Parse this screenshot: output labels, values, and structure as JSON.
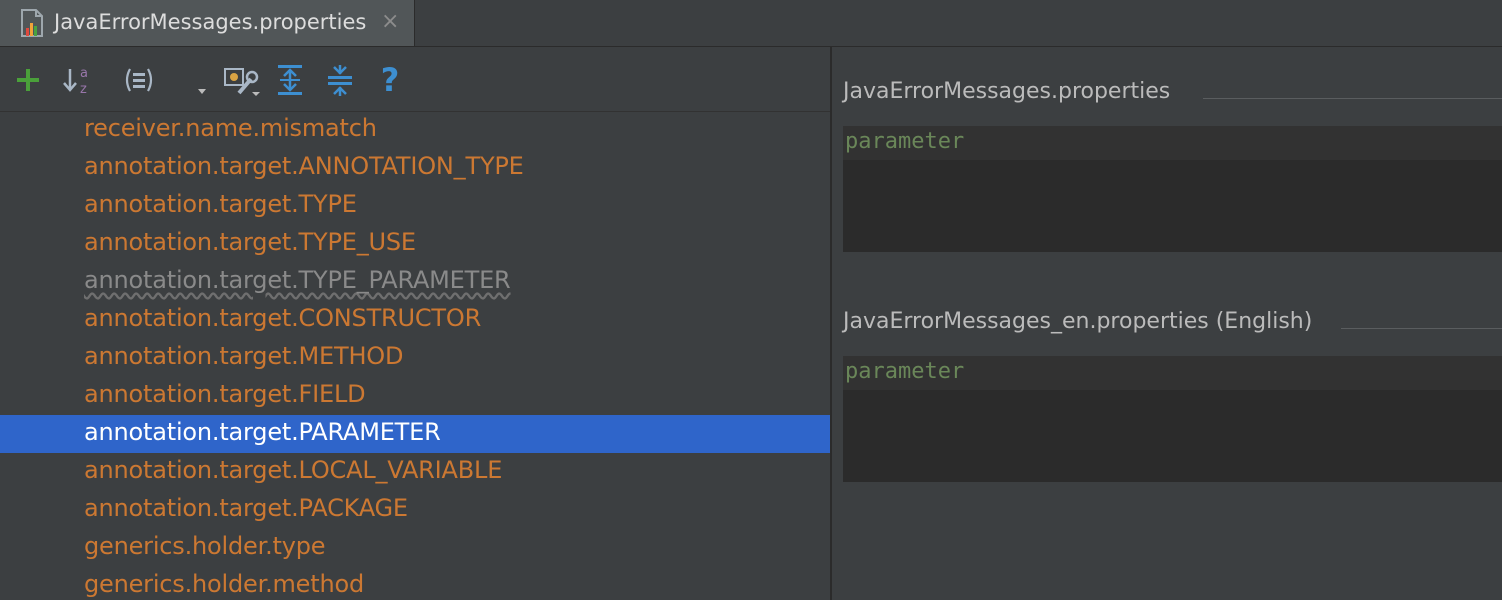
{
  "tab": {
    "title": "JavaErrorMessages.properties",
    "close": "×",
    "icon": "properties-file-icon"
  },
  "toolbar": {
    "buttons": [
      {
        "name": "add-property-button",
        "icon": "plus-icon"
      },
      {
        "name": "sort-alphabetically-button",
        "icon": "sort-az-icon"
      },
      {
        "name": "group-by-prefix-button",
        "icon": "group-icon"
      },
      {
        "name": "settings-dropdown-button",
        "icon": "settings-wrench-icon"
      },
      {
        "name": "expand-all-button",
        "icon": "expand-all-icon"
      },
      {
        "name": "collapse-all-button",
        "icon": "collapse-all-icon"
      },
      {
        "name": "help-button",
        "icon": "help-icon"
      }
    ],
    "help_label": "?",
    "colors": {
      "add": "#4aa03a",
      "action": "#3d8fd1"
    }
  },
  "keys": {
    "items": [
      {
        "label": "receiver.name.mismatch",
        "state": "normal"
      },
      {
        "label": "annotation.target.ANNOTATION_TYPE",
        "state": "normal"
      },
      {
        "label": "annotation.target.TYPE",
        "state": "normal"
      },
      {
        "label": "annotation.target.TYPE_USE",
        "state": "normal"
      },
      {
        "label": "annotation.target.TYPE_PARAMETER",
        "state": "unused"
      },
      {
        "label": "annotation.target.CONSTRUCTOR",
        "state": "normal"
      },
      {
        "label": "annotation.target.METHOD",
        "state": "normal"
      },
      {
        "label": "annotation.target.FIELD",
        "state": "normal"
      },
      {
        "label": "annotation.target.PARAMETER",
        "state": "selected"
      },
      {
        "label": "annotation.target.LOCAL_VARIABLE",
        "state": "normal"
      },
      {
        "label": "annotation.target.PACKAGE",
        "state": "normal"
      },
      {
        "label": "generics.holder.type",
        "state": "normal"
      },
      {
        "label": "generics.holder.method",
        "state": "normal"
      }
    ],
    "colors": {
      "key": "#cc7832",
      "selected_bg": "#2f65ca",
      "unused": "#8a8a8a"
    }
  },
  "editors": [
    {
      "file": "JavaErrorMessages.properties",
      "value": "parameter"
    },
    {
      "file": "JavaErrorMessages_en.properties (English)",
      "value": "parameter"
    }
  ]
}
